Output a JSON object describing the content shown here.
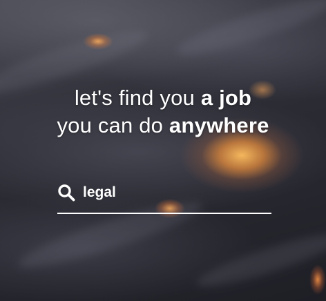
{
  "hero": {
    "line1_prefix": "let's find you ",
    "line1_emphasis": "a job",
    "line2_prefix": "you can do ",
    "line2_emphasis": "anywhere"
  },
  "search": {
    "icon": "search-icon",
    "value": "legal"
  },
  "colors": {
    "text": "#ffffff",
    "underline": "#ffffff",
    "glow": "#f2a25a"
  }
}
